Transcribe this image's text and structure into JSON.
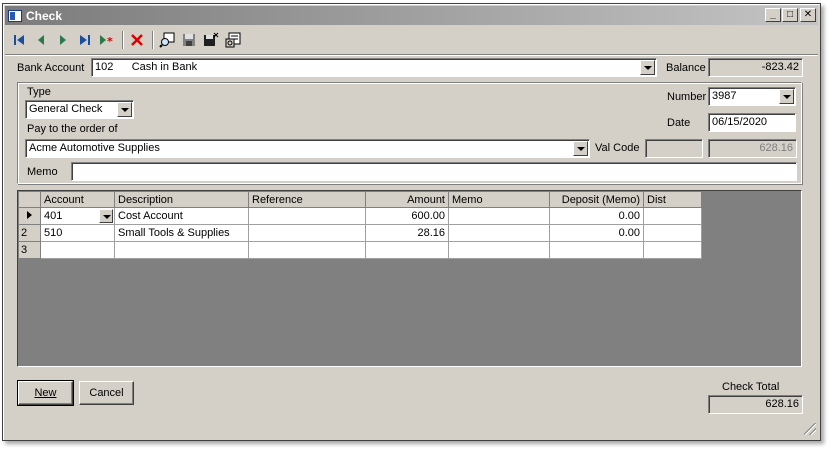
{
  "window": {
    "title": "Check"
  },
  "toolbar": {
    "icons": [
      "first-record-icon",
      "previous-record-icon",
      "next-record-icon",
      "last-record-icon",
      "new-record-icon",
      "delete-icon",
      "find-icon",
      "save-icon",
      "save-close-icon",
      "properties-icon"
    ]
  },
  "header": {
    "bank_account_label": "Bank Account",
    "bank_account_value": "102      Cash in Bank",
    "balance_label": "Balance",
    "balance_value": "-823.42",
    "type_label": "Type",
    "type_value": "General Check",
    "pay_to_label": "Pay to the order of",
    "pay_to_value": "Acme Automotive Supplies",
    "number_label": "Number",
    "number_value": "3987",
    "date_label": "Date",
    "date_value": "06/15/2020",
    "val_code_label": "Val Code",
    "val_code_value": "",
    "amount_value": "628.16",
    "memo_label": "Memo",
    "memo_value": ""
  },
  "grid": {
    "columns": [
      "Account",
      "Description",
      "Reference",
      "Amount",
      "Memo",
      "Deposit (Memo)",
      "Dist"
    ],
    "rows": [
      {
        "num": "",
        "account": "401",
        "description": "Cost Account",
        "reference": "",
        "amount": "600.00",
        "memo": "",
        "deposit": "0.00",
        "dist": ""
      },
      {
        "num": "2",
        "account": "510",
        "description": "Small Tools & Supplies",
        "reference": "",
        "amount": "28.16",
        "memo": "",
        "deposit": "0.00",
        "dist": ""
      },
      {
        "num": "3",
        "account": "",
        "description": "",
        "reference": "",
        "amount": "",
        "memo": "",
        "deposit": "",
        "dist": ""
      }
    ]
  },
  "footer": {
    "new_label": "New",
    "cancel_label": "Cancel",
    "check_total_label": "Check Total",
    "check_total_value": "628.16"
  },
  "colors": {
    "titlebar_start": "#7b7b7b",
    "titlebar_end": "#c4c4c4",
    "face": "#d4d0c8",
    "grid_bg": "#808080"
  }
}
